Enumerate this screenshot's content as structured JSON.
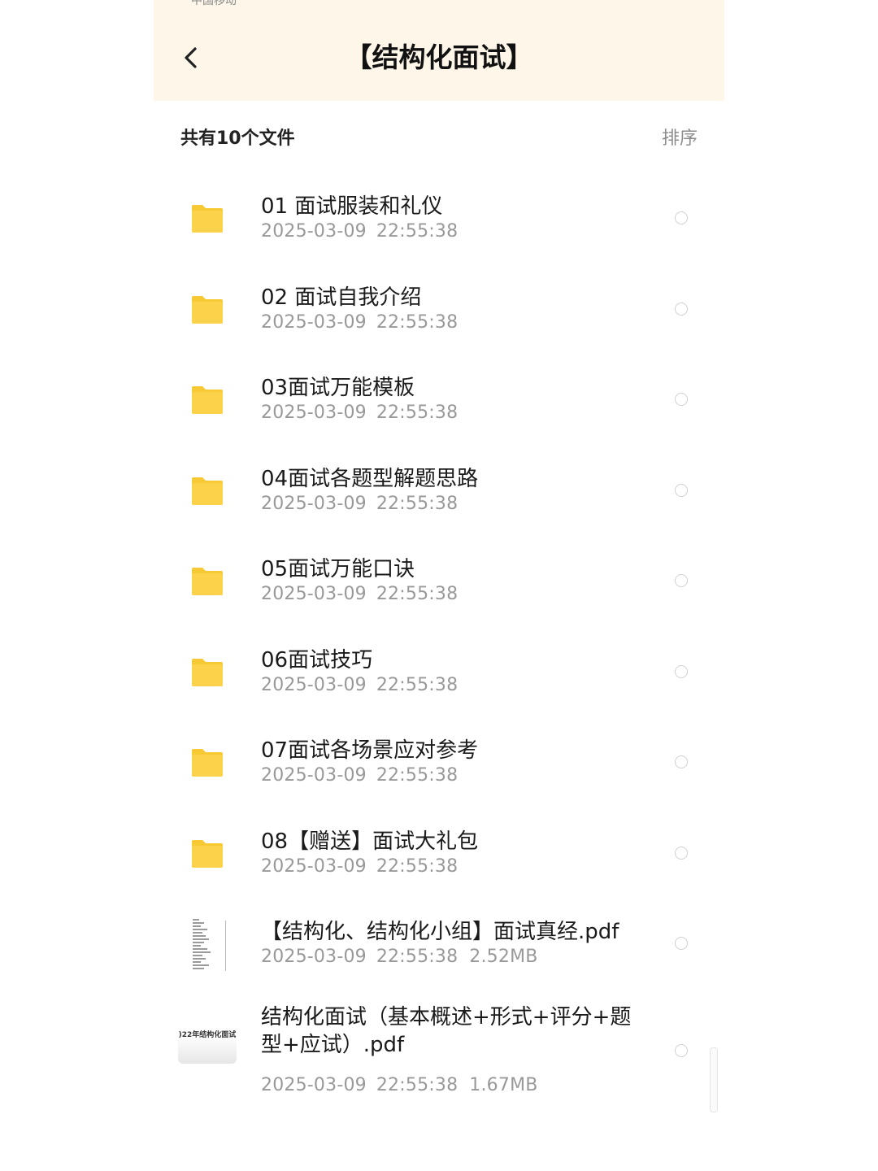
{
  "status_bar": {
    "carrier": "中国移动"
  },
  "header": {
    "title": "【结构化面试】"
  },
  "summary": {
    "count_text": "共有10个文件",
    "sort_label": "排序"
  },
  "theme": {
    "folder_color": "#fbd24a",
    "folder_tab_color": "#f7c934",
    "header_bg": "#fdf6e9"
  },
  "files": [
    {
      "name": "01  面试服装和礼仪",
      "date": "2025-03-09",
      "time": "22:55:38",
      "size": "",
      "icon": "folder-icon"
    },
    {
      "name": "02  面试自我介绍",
      "date": "2025-03-09",
      "time": "22:55:38",
      "size": "",
      "icon": "folder-icon"
    },
    {
      "name": "03面试万能模板",
      "date": "2025-03-09",
      "time": "22:55:38",
      "size": "",
      "icon": "folder-icon"
    },
    {
      "name": "04面试各题型解题思路",
      "date": "2025-03-09",
      "time": "22:55:38",
      "size": "",
      "icon": "folder-icon"
    },
    {
      "name": "05面试万能口诀",
      "date": "2025-03-09",
      "time": "22:55:38",
      "size": "",
      "icon": "folder-icon"
    },
    {
      "name": "06面试技巧",
      "date": "2025-03-09",
      "time": "22:55:38",
      "size": "",
      "icon": "folder-icon"
    },
    {
      "name": "07面试各场景应对参考",
      "date": "2025-03-09",
      "time": "22:55:38",
      "size": "",
      "icon": "folder-icon"
    },
    {
      "name": "08【赠送】面试大礼包",
      "date": "2025-03-09",
      "time": "22:55:38",
      "size": "",
      "icon": "folder-icon"
    },
    {
      "name": "【结构化、结构化小组】面试真经.pdf",
      "date": "2025-03-09",
      "time": "22:55:38",
      "size": "2.52MB",
      "icon": "pdf-thumbnail"
    },
    {
      "name": "结构化面试（基本概述+形式+评分+题型+应试）.pdf",
      "date": "2025-03-09",
      "time": "22:55:38",
      "size": "1.67MB",
      "icon": "pdf-thumbnail",
      "thumb_text": ")22年结构化面试"
    }
  ]
}
